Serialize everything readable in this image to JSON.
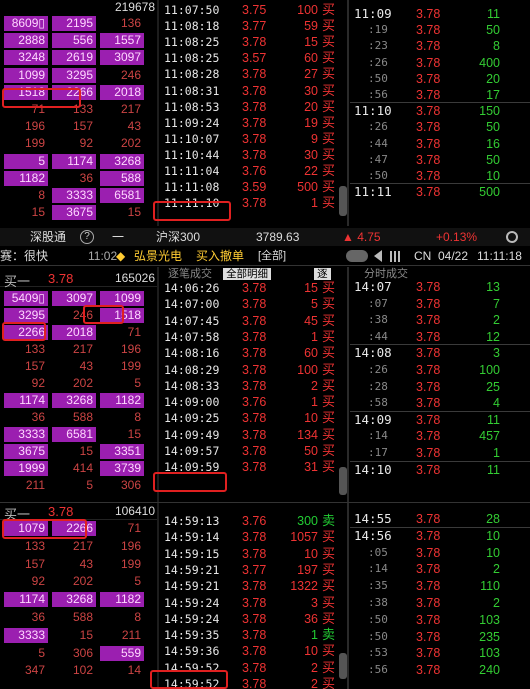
{
  "panels": [
    {
      "id": "p1",
      "header_total": "219678",
      "buy1": null,
      "queue": [
        [
          "8609▯",
          "2195",
          "136"
        ],
        [
          "2888",
          "556",
          "1557"
        ],
        [
          "3248",
          "2619",
          "3097"
        ],
        [
          "1099",
          "3295",
          "246"
        ],
        [
          "1518",
          "2266",
          "2018"
        ],
        [
          "71",
          "133",
          "217"
        ],
        [
          "196",
          "157",
          "43"
        ],
        [
          "199",
          "92",
          "202"
        ],
        [
          "5",
          "1174",
          "3268"
        ],
        [
          "1182",
          "36",
          "588"
        ],
        [
          "8",
          "3333",
          "6581"
        ],
        [
          "15",
          "3675",
          "15"
        ]
      ],
      "ticks": [
        [
          "11:07:50",
          "3.75",
          "100",
          "买"
        ],
        [
          "11:08:18",
          "3.77",
          "59",
          "买"
        ],
        [
          "11:08:25",
          "3.78",
          "15",
          "买"
        ],
        [
          "11:08:25",
          "3.57",
          "60",
          "买"
        ],
        [
          "11:08:28",
          "3.78",
          "27",
          "买"
        ],
        [
          "11:08:31",
          "3.78",
          "30",
          "买"
        ],
        [
          "11:08:53",
          "3.78",
          "20",
          "买"
        ],
        [
          "11:09:24",
          "3.78",
          "19",
          "买"
        ],
        [
          "11:10:07",
          "3.78",
          "9",
          "买"
        ],
        [
          "11:10:44",
          "3.78",
          "30",
          "买"
        ],
        [
          "11:11:04",
          "3.76",
          "22",
          "买"
        ],
        [
          "11:11:08",
          "3.59",
          "500",
          "买"
        ],
        [
          "11:11:10",
          "3.78",
          "1",
          "买"
        ]
      ],
      "minute": [
        [
          "11:09",
          "3.78",
          "11",
          false
        ],
        [
          ":19",
          "3.78",
          "50",
          true
        ],
        [
          ":23",
          "3.78",
          "8",
          true
        ],
        [
          ":26",
          "3.78",
          "400",
          true
        ],
        [
          ":50",
          "3.78",
          "20",
          true
        ],
        [
          ":56",
          "3.78",
          "17",
          true
        ],
        [
          "11:10",
          "3.78",
          "150",
          false
        ],
        [
          ":26",
          "3.78",
          "50",
          true
        ],
        [
          ":44",
          "3.78",
          "16",
          true
        ],
        [
          ":47",
          "3.78",
          "50",
          true
        ],
        [
          ":50",
          "3.78",
          "10",
          true
        ],
        [
          "11:11",
          "3.78",
          "500",
          false
        ]
      ]
    },
    {
      "id": "p2",
      "header_total": "165026",
      "buy1": {
        "label": "买一",
        "price": "3.78"
      },
      "queue": [
        [
          "5409▯",
          "3097",
          "1099"
        ],
        [
          "3295",
          "246",
          "1518"
        ],
        [
          "2266",
          "2018",
          "71"
        ],
        [
          "133",
          "217",
          "196"
        ],
        [
          "157",
          "43",
          "199"
        ],
        [
          "92",
          "202",
          "5"
        ],
        [
          "1174",
          "3268",
          "1182"
        ],
        [
          "36",
          "588",
          "8"
        ],
        [
          "3333",
          "6581",
          "15"
        ],
        [
          "3675",
          "15",
          "3351"
        ],
        [
          "1999",
          "414",
          "3739"
        ],
        [
          "211",
          "5",
          "306"
        ]
      ],
      "ticks": [
        [
          "14:06:26",
          "3.78",
          "15",
          "买"
        ],
        [
          "14:07:00",
          "3.78",
          "5",
          "买"
        ],
        [
          "14:07:45",
          "3.78",
          "45",
          "买"
        ],
        [
          "14:07:58",
          "3.78",
          "1",
          "买"
        ],
        [
          "14:08:16",
          "3.78",
          "60",
          "买"
        ],
        [
          "14:08:29",
          "3.78",
          "100",
          "买"
        ],
        [
          "14:08:33",
          "3.78",
          "2",
          "买"
        ],
        [
          "14:09:00",
          "3.76",
          "1",
          "买"
        ],
        [
          "14:09:25",
          "3.78",
          "10",
          "买"
        ],
        [
          "14:09:49",
          "3.78",
          "134",
          "买"
        ],
        [
          "14:09:57",
          "3.78",
          "50",
          "买"
        ],
        [
          "14:09:59",
          "3.78",
          "31",
          "买"
        ]
      ],
      "minute": [
        [
          "14:07",
          "3.78",
          "13",
          false
        ],
        [
          ":07",
          "3.78",
          "7",
          true
        ],
        [
          ":38",
          "3.78",
          "2",
          true
        ],
        [
          ":44",
          "3.78",
          "12",
          true
        ],
        [
          "14:08",
          "3.78",
          "3",
          false
        ],
        [
          ":26",
          "3.78",
          "100",
          true
        ],
        [
          ":28",
          "3.78",
          "25",
          true
        ],
        [
          ":58",
          "3.78",
          "4",
          true
        ],
        [
          "14:09",
          "3.78",
          "11",
          false
        ],
        [
          ":14",
          "3.78",
          "457",
          true
        ],
        [
          ":17",
          "3.78",
          "1",
          true
        ],
        [
          "14:10",
          "3.78",
          "11",
          false
        ]
      ]
    },
    {
      "id": "p3",
      "header_total": "106410",
      "buy1": {
        "label": "买一",
        "price": "3.78"
      },
      "queue": [
        [
          "1079",
          "2266",
          "71"
        ],
        [
          "133",
          "217",
          "196"
        ],
        [
          "157",
          "43",
          "199"
        ],
        [
          "92",
          "202",
          "5"
        ],
        [
          "1174",
          "3268",
          "1182"
        ],
        [
          "36",
          "588",
          "8"
        ],
        [
          "3333",
          "15",
          "211"
        ],
        [
          "5",
          "306",
          "559"
        ],
        [
          "347",
          "102",
          "14"
        ]
      ],
      "ticks": [
        [
          "14:59:13",
          "3.76",
          "300",
          "卖"
        ],
        [
          "14:59:14",
          "3.78",
          "1057",
          "买"
        ],
        [
          "14:59:15",
          "3.78",
          "10",
          "买"
        ],
        [
          "14:59:21",
          "3.77",
          "197",
          "买"
        ],
        [
          "14:59:21",
          "3.78",
          "1322",
          "买"
        ],
        [
          "14:59:24",
          "3.78",
          "3",
          "买"
        ],
        [
          "14:59:24",
          "3.78",
          "36",
          "买"
        ],
        [
          "14:59:35",
          "3.78",
          "1",
          "卖"
        ],
        [
          "14:59:36",
          "3.78",
          "10",
          "买"
        ],
        [
          "14:59:52",
          "3.78",
          "2",
          "买"
        ],
        [
          "14:59:52",
          "3.78",
          "2",
          "买"
        ]
      ],
      "minute": [
        [
          "14:55",
          "3.78",
          "28",
          false
        ],
        [
          "14:56",
          "3.78",
          "10",
          false
        ],
        [
          ":05",
          "3.78",
          "10",
          true
        ],
        [
          ":14",
          "3.78",
          "2",
          true
        ],
        [
          ":35",
          "3.78",
          "110",
          true
        ],
        [
          ":38",
          "3.78",
          "2",
          true
        ],
        [
          ":50",
          "3.78",
          "103",
          true
        ],
        [
          ":50",
          "3.78",
          "235",
          true
        ],
        [
          ":53",
          "3.78",
          "103",
          true
        ],
        [
          ":56",
          "3.78",
          "240",
          true
        ]
      ]
    }
  ],
  "ticker_bar": {
    "shengutong": "深股通",
    "help": "?",
    "dash": "一",
    "index_name": "沪深300",
    "index_value": "3789.63",
    "change": "▲ 4.75",
    "change_pct": "+0.13%"
  },
  "news_bar": {
    "left_text": "赛：很快",
    "time": "11:02",
    "diamond": "◆",
    "stock": "弘景光电",
    "action": "买入撤单",
    "filter": "[全部]",
    "region": "CN",
    "date": "04/22",
    "clock": "11:11:18"
  },
  "subheaders": {
    "p2_mid": "逐笔成交",
    "p2_tab1": "全部明细",
    "p2_tab2": "逐",
    "p2_right": "分时成交"
  },
  "colors": {
    "red": "#ee3333",
    "green": "#22cc33",
    "magenta": "#9b1fb0",
    "highlight": "#e02020"
  }
}
